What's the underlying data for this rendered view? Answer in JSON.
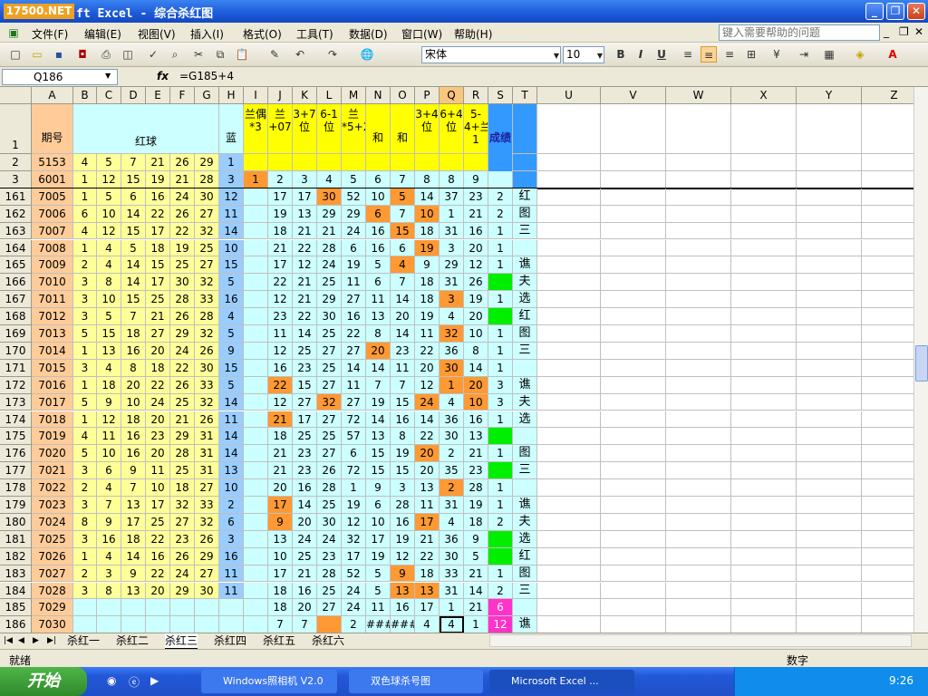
{
  "title": {
    "logo": "17500.NET",
    "text": "ft Excel - 综合杀红图",
    "min": "_",
    "max": "❐",
    "close": "✕"
  },
  "menu": {
    "items": [
      "文件(F)",
      "编辑(E)",
      "视图(V)",
      "插入(I)",
      "格式(O)",
      "工具(T)",
      "数据(D)",
      "窗口(W)",
      "帮助(H)"
    ],
    "help_placeholder": "键入需要帮助的问题"
  },
  "toolbar": {
    "font": "宋体",
    "size": "10",
    "bold": "B",
    "italic": "I",
    "underline": "U"
  },
  "formula": {
    "namebox": "Q186",
    "fx": "fx",
    "content": "=G185+4"
  },
  "columns": [
    "A",
    "B",
    "C",
    "D",
    "E",
    "F",
    "G",
    "H",
    "I",
    "J",
    "K",
    "L",
    "M",
    "N",
    "O",
    "P",
    "Q",
    "R",
    "S",
    "T",
    "U",
    "V",
    "W",
    "X",
    "Y",
    "Z"
  ],
  "header_cells": {
    "h1_period": "期号",
    "h1_red": "红球",
    "h1_blue": "蓝",
    "h1_i": "兰偶*3",
    "h1_j": "兰+07",
    "h1_k": "3+7位",
    "h1_l": "6-1位",
    "h1_m": "兰*5+2",
    "h1_n": "和",
    "h1_o": "和",
    "h1_p": "3+4位",
    "h1_q": "6+4位",
    "h1_r": "5-4+兰1",
    "h1_s": "成绩"
  },
  "rows_top": [
    {
      "n": "2",
      "cells": [
        "5153",
        "4",
        "5",
        "7",
        "21",
        "26",
        "29",
        "1",
        "",
        "",
        "",
        "",
        "",
        "",
        "",
        "",
        "",
        "",
        ""
      ]
    },
    {
      "n": "3",
      "cells": [
        "6001",
        "1",
        "12",
        "15",
        "19",
        "21",
        "28",
        "3",
        "1",
        "2",
        "3",
        "4",
        "5",
        "6",
        "7",
        "8",
        "8",
        "9",
        ""
      ]
    }
  ],
  "rows": [
    {
      "n": "161",
      "c": [
        "7005",
        "1",
        "5",
        "6",
        "16",
        "24",
        "30",
        "12",
        "",
        "17",
        "17",
        "30",
        "52",
        "10",
        "5",
        "14",
        "37",
        "23",
        "2",
        "红"
      ]
    },
    {
      "n": "162",
      "c": [
        "7006",
        "6",
        "10",
        "14",
        "22",
        "26",
        "27",
        "11",
        "",
        "19",
        "13",
        "29",
        "29",
        "6",
        "7",
        "10",
        "1",
        "21",
        "2",
        "图"
      ]
    },
    {
      "n": "163",
      "c": [
        "7007",
        "4",
        "12",
        "15",
        "17",
        "22",
        "32",
        "14",
        "",
        "18",
        "21",
        "21",
        "24",
        "16",
        "15",
        "18",
        "31",
        "16",
        "1",
        "三"
      ]
    },
    {
      "n": "164",
      "c": [
        "7008",
        "1",
        "4",
        "5",
        "18",
        "19",
        "25",
        "10",
        "",
        "21",
        "22",
        "28",
        "6",
        "16",
        "6",
        "19",
        "3",
        "20",
        "1",
        ""
      ]
    },
    {
      "n": "165",
      "c": [
        "7009",
        "2",
        "4",
        "14",
        "15",
        "25",
        "27",
        "15",
        "",
        "17",
        "12",
        "24",
        "19",
        "5",
        "4",
        "9",
        "29",
        "12",
        "1",
        "谯"
      ]
    },
    {
      "n": "166",
      "c": [
        "7010",
        "3",
        "8",
        "14",
        "17",
        "30",
        "32",
        "5",
        "",
        "22",
        "21",
        "25",
        "11",
        "6",
        "7",
        "18",
        "31",
        "26",
        "",
        "夫"
      ]
    },
    {
      "n": "167",
      "c": [
        "7011",
        "3",
        "10",
        "15",
        "25",
        "28",
        "33",
        "16",
        "",
        "12",
        "21",
        "29",
        "27",
        "11",
        "14",
        "18",
        "3",
        "19",
        "1",
        "选"
      ]
    },
    {
      "n": "168",
      "c": [
        "7012",
        "3",
        "5",
        "7",
        "21",
        "26",
        "28",
        "4",
        "",
        "23",
        "22",
        "30",
        "16",
        "13",
        "20",
        "19",
        "4",
        "20",
        "",
        "红"
      ]
    },
    {
      "n": "169",
      "c": [
        "7013",
        "5",
        "15",
        "18",
        "27",
        "29",
        "32",
        "5",
        "",
        "11",
        "14",
        "25",
        "22",
        "8",
        "14",
        "11",
        "32",
        "10",
        "1",
        "图"
      ]
    },
    {
      "n": "170",
      "c": [
        "7014",
        "1",
        "13",
        "16",
        "20",
        "24",
        "26",
        "9",
        "",
        "12",
        "25",
        "27",
        "27",
        "20",
        "23",
        "22",
        "36",
        "8",
        "1",
        "三"
      ]
    },
    {
      "n": "171",
      "c": [
        "7015",
        "3",
        "4",
        "8",
        "18",
        "22",
        "30",
        "15",
        "",
        "16",
        "23",
        "25",
        "14",
        "14",
        "11",
        "20",
        "30",
        "14",
        "1",
        ""
      ]
    },
    {
      "n": "172",
      "c": [
        "7016",
        "1",
        "18",
        "20",
        "22",
        "26",
        "33",
        "5",
        "",
        "22",
        "15",
        "27",
        "11",
        "7",
        "7",
        "12",
        "1",
        "20",
        "3",
        "谯"
      ]
    },
    {
      "n": "173",
      "c": [
        "7017",
        "5",
        "9",
        "10",
        "24",
        "25",
        "32",
        "14",
        "",
        "12",
        "27",
        "32",
        "27",
        "19",
        "15",
        "24",
        "4",
        "10",
        "3",
        "夫"
      ]
    },
    {
      "n": "174",
      "c": [
        "7018",
        "1",
        "12",
        "18",
        "20",
        "21",
        "26",
        "11",
        "",
        "21",
        "17",
        "27",
        "72",
        "14",
        "16",
        "14",
        "36",
        "16",
        "1",
        "选"
      ]
    },
    {
      "n": "175",
      "c": [
        "7019",
        "4",
        "11",
        "16",
        "23",
        "29",
        "31",
        "14",
        "",
        "18",
        "25",
        "25",
        "57",
        "13",
        "8",
        "22",
        "30",
        "13",
        "",
        ""
      ]
    },
    {
      "n": "176",
      "c": [
        "7020",
        "5",
        "10",
        "16",
        "20",
        "28",
        "31",
        "14",
        "",
        "21",
        "23",
        "27",
        "6",
        "15",
        "19",
        "20",
        "2",
        "21",
        "1",
        "图"
      ]
    },
    {
      "n": "177",
      "c": [
        "7021",
        "3",
        "6",
        "9",
        "11",
        "25",
        "31",
        "13",
        "",
        "21",
        "23",
        "26",
        "72",
        "15",
        "15",
        "20",
        "35",
        "23",
        "",
        "三"
      ]
    },
    {
      "n": "178",
      "c": [
        "7022",
        "2",
        "4",
        "7",
        "10",
        "18",
        "27",
        "10",
        "",
        "20",
        "16",
        "28",
        "1",
        "9",
        "3",
        "13",
        "2",
        "28",
        "1",
        ""
      ]
    },
    {
      "n": "179",
      "c": [
        "7023",
        "3",
        "7",
        "13",
        "17",
        "32",
        "33",
        "2",
        "",
        "17",
        "14",
        "25",
        "19",
        "6",
        "28",
        "11",
        "31",
        "19",
        "1",
        "谯"
      ]
    },
    {
      "n": "180",
      "c": [
        "7024",
        "8",
        "9",
        "17",
        "25",
        "27",
        "32",
        "6",
        "",
        "9",
        "20",
        "30",
        "12",
        "10",
        "16",
        "17",
        "4",
        "18",
        "2",
        "夫"
      ]
    },
    {
      "n": "181",
      "c": [
        "7025",
        "3",
        "16",
        "18",
        "22",
        "23",
        "26",
        "3",
        "",
        "13",
        "24",
        "24",
        "32",
        "17",
        "19",
        "21",
        "36",
        "9",
        "",
        "选"
      ]
    },
    {
      "n": "182",
      "c": [
        "7026",
        "1",
        "4",
        "14",
        "16",
        "26",
        "29",
        "16",
        "",
        "10",
        "25",
        "23",
        "17",
        "19",
        "12",
        "22",
        "30",
        "5",
        "",
        "红"
      ]
    },
    {
      "n": "183",
      "c": [
        "7027",
        "2",
        "3",
        "9",
        "22",
        "24",
        "27",
        "11",
        "",
        "17",
        "21",
        "28",
        "52",
        "5",
        "9",
        "18",
        "33",
        "21",
        "1",
        "图"
      ]
    },
    {
      "n": "184",
      "c": [
        "7028",
        "3",
        "8",
        "13",
        "20",
        "29",
        "30",
        "11",
        "",
        "18",
        "16",
        "25",
        "24",
        "5",
        "13",
        "13",
        "31",
        "14",
        "2",
        "三"
      ]
    },
    {
      "n": "185",
      "c": [
        "7029",
        "",
        "",
        "",
        "",
        "",
        "",
        "",
        "",
        "18",
        "20",
        "27",
        "24",
        "11",
        "16",
        "17",
        "1",
        "21",
        "6",
        ""
      ]
    },
    {
      "n": "186",
      "c": [
        "7030",
        "",
        "",
        "",
        "",
        "",
        "",
        "",
        "",
        "7",
        "7",
        "",
        "2",
        "###",
        "###",
        "4",
        "4",
        "1",
        "12",
        "谯"
      ]
    }
  ],
  "sheets": [
    "杀红一",
    "杀红二",
    "杀红三",
    "杀红四",
    "杀红五",
    "杀红六"
  ],
  "status": {
    "ready": "就绪",
    "mode": "数字"
  },
  "taskbar": {
    "start": "开始",
    "tasks": [
      "Windows照相机 V2.0",
      "双色球杀号图",
      "Microsoft Excel ..."
    ],
    "clock": "9:26"
  },
  "colors": {
    "yellow": "#ffff99",
    "blue": "#99ccff",
    "cyan": "#ccffff",
    "orange": "#ff9933",
    "green": "#00ee00",
    "magenta": "#ff33cc",
    "peach": "#ffcc99",
    "header_yellow": "#ffff00"
  }
}
